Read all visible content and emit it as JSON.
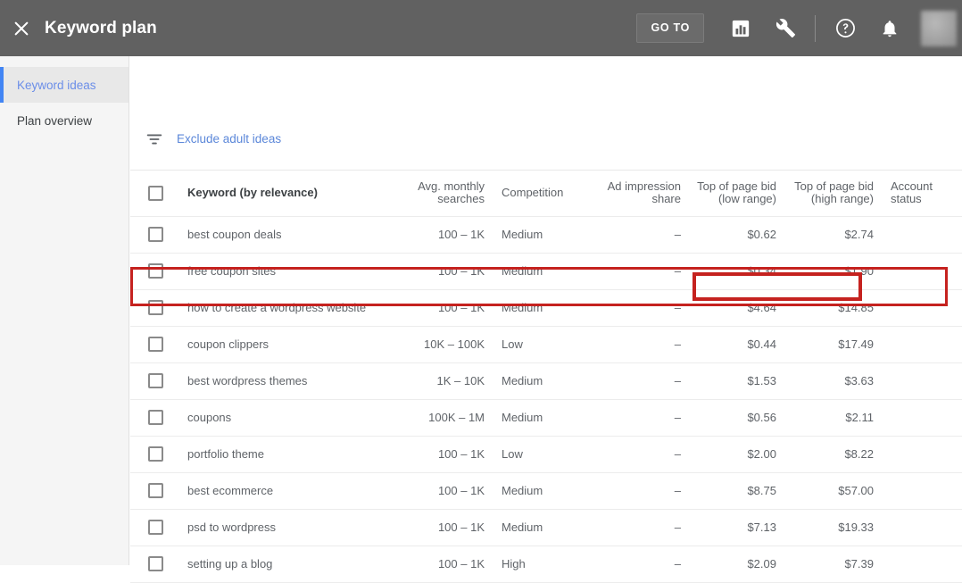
{
  "topbar": {
    "close_icon": "close-icon",
    "title": "Keyword plan",
    "goto_label": "GO TO",
    "icons": [
      {
        "name": "reports-bar-chart-icon",
        "glyph": "bar-chart"
      },
      {
        "name": "tools-wrench-icon",
        "glyph": "wrench"
      },
      {
        "name": "help-icon",
        "glyph": "question-circle"
      },
      {
        "name": "notifications-bell-icon",
        "glyph": "bell"
      }
    ],
    "avatar_label": "",
    "background_color": "#616161"
  },
  "sidebar": {
    "items": [
      {
        "label": "Keyword ideas",
        "active": true
      },
      {
        "label": "Plan overview",
        "active": false
      }
    ],
    "active_accent_color": "#4285f4",
    "background_color": "#f5f5f5"
  },
  "filterbar": {
    "filter_icon": "filter-funnel-icon",
    "link_label": "Exclude adult ideas",
    "link_color": "#5b87d9"
  },
  "table": {
    "columns": [
      {
        "key": "checkbox",
        "label": ""
      },
      {
        "key": "keyword",
        "label": "Keyword (by relevance)"
      },
      {
        "key": "avg_monthly_searches",
        "label": "Avg. monthly searches"
      },
      {
        "key": "competition",
        "label": "Competition"
      },
      {
        "key": "ad_impression_share",
        "label": "Ad impression share"
      },
      {
        "key": "top_of_page_bid_low",
        "label": "Top of page bid (low range)"
      },
      {
        "key": "top_of_page_bid_high",
        "label": "Top of page bid (high range)"
      },
      {
        "key": "account_status",
        "label": "Account status"
      }
    ],
    "header_labels": {
      "keyword": "Keyword (by relevance)",
      "avg_line1": "Avg. monthly",
      "avg_line2": "searches",
      "competition": "Competition",
      "ais_line1": "Ad impression",
      "ais_line2": "share",
      "low_line1": "Top of page bid",
      "low_line2": "(low range)",
      "high_line1": "Top of page bid",
      "high_line2": "(high range)",
      "account_status": "Account status"
    },
    "rows": [
      {
        "keyword": "best coupon deals",
        "avg": "100 – 1K",
        "competition": "Medium",
        "ais": "–",
        "bid_low": "$0.62",
        "bid_high": "$2.74",
        "account_status": "",
        "highlighted": false
      },
      {
        "keyword": "free coupon sites",
        "avg": "100 – 1K",
        "competition": "Medium",
        "ais": "–",
        "bid_low": "$0.34",
        "bid_high": "$1.90",
        "account_status": "",
        "highlighted": false
      },
      {
        "keyword": "how to create a wordpress website",
        "avg": "100 – 1K",
        "competition": "Medium",
        "ais": "–",
        "bid_low": "$4.64",
        "bid_high": "$14.85",
        "account_status": "",
        "highlighted": true
      },
      {
        "keyword": "coupon clippers",
        "avg": "10K – 100K",
        "competition": "Low",
        "ais": "–",
        "bid_low": "$0.44",
        "bid_high": "$17.49",
        "account_status": "",
        "highlighted": false
      },
      {
        "keyword": "best wordpress themes",
        "avg": "1K – 10K",
        "competition": "Medium",
        "ais": "–",
        "bid_low": "$1.53",
        "bid_high": "$3.63",
        "account_status": "",
        "highlighted": false
      },
      {
        "keyword": "coupons",
        "avg": "100K – 1M",
        "competition": "Medium",
        "ais": "–",
        "bid_low": "$0.56",
        "bid_high": "$2.11",
        "account_status": "",
        "highlighted": false
      },
      {
        "keyword": "portfolio theme",
        "avg": "100 – 1K",
        "competition": "Low",
        "ais": "–",
        "bid_low": "$2.00",
        "bid_high": "$8.22",
        "account_status": "",
        "highlighted": false
      },
      {
        "keyword": "best ecommerce",
        "avg": "100 – 1K",
        "competition": "Medium",
        "ais": "–",
        "bid_low": "$8.75",
        "bid_high": "$57.00",
        "account_status": "",
        "highlighted": false
      },
      {
        "keyword": "psd to wordpress",
        "avg": "100 – 1K",
        "competition": "Medium",
        "ais": "–",
        "bid_low": "$7.13",
        "bid_high": "$19.33",
        "account_status": "",
        "highlighted": false
      },
      {
        "keyword": "setting up a blog",
        "avg": "100 – 1K",
        "competition": "High",
        "ais": "–",
        "bid_low": "$2.09",
        "bid_high": "$7.39",
        "account_status": "",
        "highlighted": false
      }
    ]
  },
  "annotations": {
    "highlight_color": "#c5221f",
    "row_box_target": "how to create a wordpress website",
    "cell_box_values": "$4.64 / $14.85"
  }
}
